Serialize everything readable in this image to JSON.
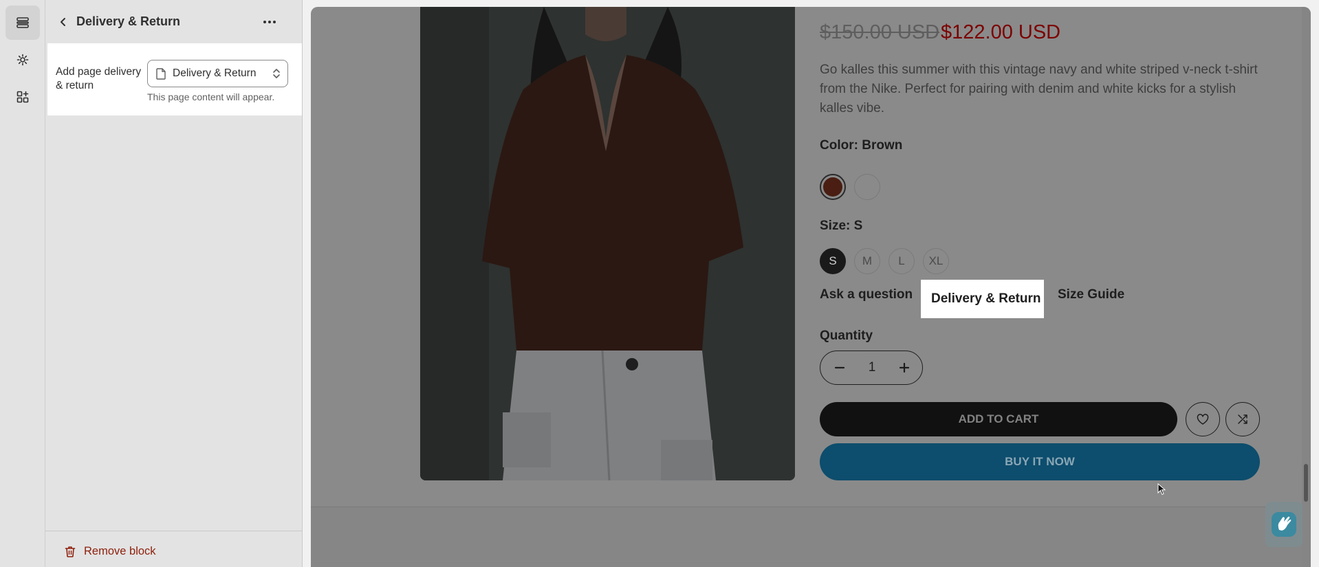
{
  "editor": {
    "panel_title": "Delivery & Return",
    "setting": {
      "label": "Add page delivery & return",
      "selected_page": "Delivery & Return",
      "help_text": "This page content will appear."
    },
    "remove_label": "Remove block"
  },
  "product": {
    "price_old": "$150.00 USD",
    "price_new": "$122.00 USD",
    "description": "Go kalles this summer with this vintage navy and white striped v-neck t-shirt from the Nike. Perfect for pairing with denim and white kicks for a stylish kalles vibe.",
    "color_label": "Color:",
    "color_value": "Brown",
    "swatches": [
      {
        "name": "Brown",
        "color": "#4a1e12",
        "selected": true
      },
      {
        "name": "White",
        "color": "#8a8a8a",
        "selected": false
      }
    ],
    "size_label": "Size:",
    "size_value": "S",
    "sizes": [
      "S",
      "M",
      "L",
      "XL"
    ],
    "links": {
      "ask": "Ask a question",
      "delivery": "Delivery & Return",
      "size_guide": "Size Guide"
    },
    "quantity_label": "Quantity",
    "quantity": "1",
    "add_to_cart": "ADD TO CART",
    "buy_now": "BUY IT NOW"
  },
  "icons": {
    "rail": [
      "sections-icon",
      "settings-gear-icon",
      "apps-icon"
    ],
    "header": [
      "back-arrow-icon",
      "more-horizontal-icon"
    ],
    "product": [
      "wishlist-heart-icon",
      "compare-shuffle-icon",
      "chat-hand-icon"
    ]
  },
  "colors": {
    "editor_bg": "#e3e3e3",
    "preview_overlay": "#8a8a8a",
    "sale_price": "#7c0202",
    "buy_now": "#0d4d6d",
    "remove": "#8e1f0b"
  }
}
